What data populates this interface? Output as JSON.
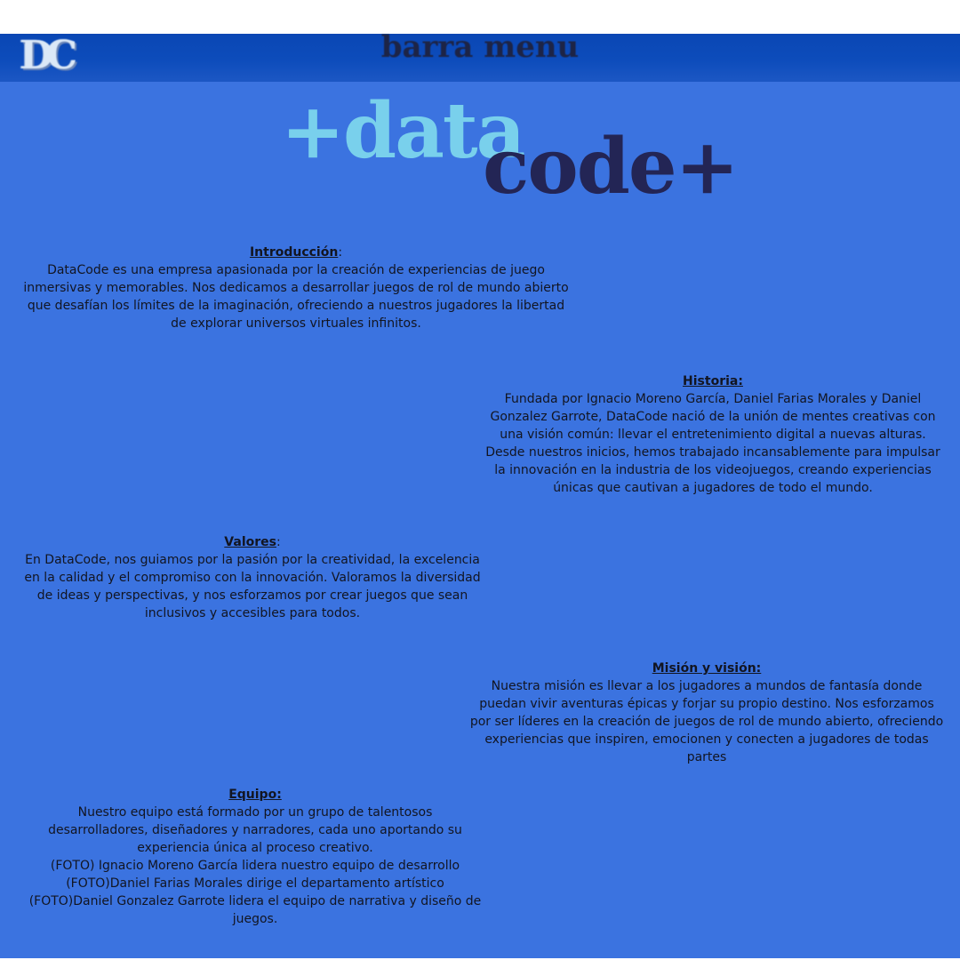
{
  "header": {
    "logo_initials": "DC",
    "menu_label": "barra menu"
  },
  "brand": {
    "prefix": "+data",
    "suffix": "code+",
    "prefix_color": "#79d0ec",
    "suffix_color": "#232555"
  },
  "colors": {
    "background": "#3b73e0",
    "menubar": "#0d4cbb",
    "text": "#121521"
  },
  "sections": {
    "intro": {
      "heading": "Introducción",
      "heading_suffix": ":",
      "body": "DataCode es una empresa apasionada por la creación de experiencias de juego inmersivas y memorables. Nos dedicamos a desarrollar juegos de rol de mundo abierto que desafían los límites de la imaginación, ofreciendo a nuestros jugadores la libertad de explorar universos virtuales infinitos."
    },
    "historia": {
      "heading": "Historia:",
      "heading_suffix": "",
      "body": "Fundada por Ignacio Moreno García, Daniel Farias Morales y Daniel Gonzalez Garrote, DataCode nació de la unión de mentes creativas con una visión común: llevar el entretenimiento digital a nuevas alturas. Desde nuestros inicios, hemos trabajado incansablemente para impulsar la innovación en la industria de los videojuegos, creando experiencias únicas que cautivan a jugadores de todo el mundo."
    },
    "valores": {
      "heading": "Valores",
      "heading_suffix": ":",
      "body": "En DataCode, nos guiamos por la pasión por la creatividad, la excelencia en la calidad y el compromiso con la innovación. Valoramos la diversidad de ideas y perspectivas, y nos esforzamos por crear juegos que sean inclusivos y accesibles para todos."
    },
    "mision": {
      "heading": "Misión y visión:",
      "heading_suffix": "",
      "body": "Nuestra misión es llevar a los jugadores a mundos de fantasía donde puedan vivir aventuras épicas y forjar su propio destino. Nos esforzamos por ser líderes en la creación de juegos de rol de mundo abierto, ofreciendo experiencias que inspiren, emocionen y conecten a jugadores de todas partes"
    },
    "equipo": {
      "heading": "Equipo:",
      "heading_suffix": "",
      "body": "Nuestro equipo está formado por un grupo de talentosos desarrolladores, diseñadores y narradores, cada uno aportando su experiencia única al proceso creativo.",
      "members": [
        "(FOTO) Ignacio Moreno García lidera nuestro equipo de desarrollo",
        "(FOTO)Daniel Farias Morales dirige el departamento artístico",
        "(FOTO)Daniel Gonzalez Garrote lidera el equipo de narrativa y diseño de juegos."
      ]
    }
  }
}
